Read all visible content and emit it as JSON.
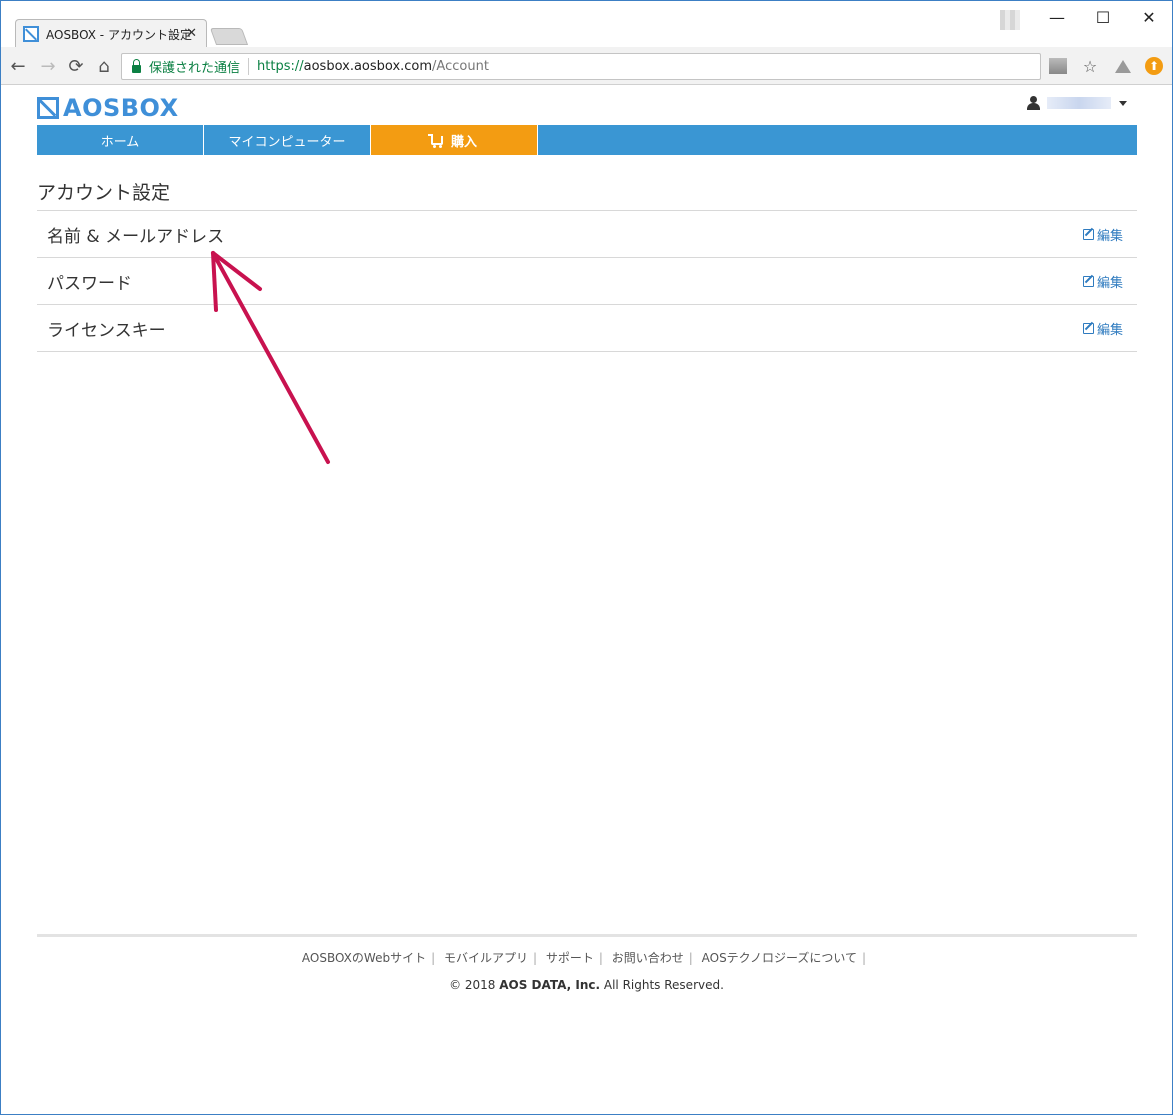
{
  "browser": {
    "tab_title": "AOSBOX - アカウント設定",
    "tab_close": "✕",
    "secure_label": "保護された通信",
    "url_scheme": "https://",
    "url_host": "aosbox.aosbox.com",
    "url_path": "/Account",
    "window_controls": {
      "minimize": "—",
      "maximize": "☐",
      "close": "✕"
    }
  },
  "header": {
    "logo_text": "AOSBOX",
    "user_icon": "user-icon"
  },
  "nav": {
    "items": [
      {
        "label": "ホーム"
      },
      {
        "label": "マイコンピューター"
      },
      {
        "label": "購入",
        "icon": "cart-icon",
        "color": "#f39c12"
      }
    ],
    "color": "#3a96d3"
  },
  "main": {
    "title": "アカウント設定",
    "rows": [
      {
        "label": "名前 & メールアドレス",
        "action": "編集"
      },
      {
        "label": "パスワード",
        "action": "編集"
      },
      {
        "label": "ライセンスキー",
        "action": "編集"
      }
    ]
  },
  "footer": {
    "links": [
      "AOSBOXのWebサイト",
      "モバイルアプリ",
      "サポート",
      "お問い合わせ",
      "AOSテクノロジーズについて"
    ],
    "separator": "|",
    "copyright_prefix": "© 2018",
    "copyright_company": "AOS DATA, Inc.",
    "copyright_suffix": "All Rights Reserved."
  },
  "colors": {
    "accent": "#3f8fd8",
    "buy": "#f39c12",
    "annotation_arrow": "#c8124f"
  }
}
